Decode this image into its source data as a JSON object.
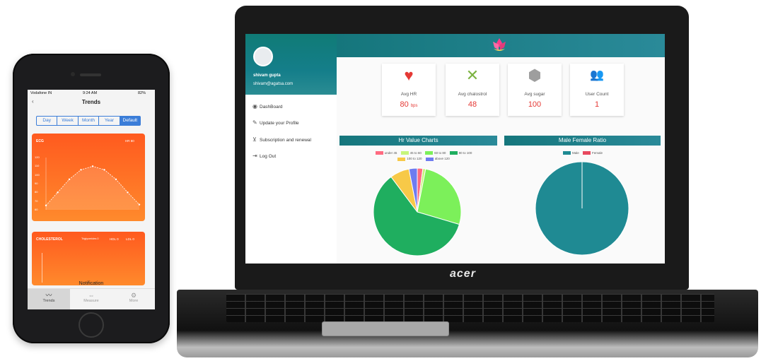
{
  "phone": {
    "status": {
      "carrier": "Vodafone IN",
      "time": "9:24 AM",
      "battery": "82%"
    },
    "title": "Trends",
    "segments": [
      "Day",
      "Week",
      "Month",
      "Year",
      "Default"
    ],
    "selected_segment": "Default",
    "ecg_card": {
      "title": "ECG",
      "right_label": "HR 80",
      "y_ticks": [
        "120",
        "110",
        "100",
        "90",
        "80",
        "70",
        "60"
      ]
    },
    "chol_card": {
      "title": "CHOLESTEROL",
      "right_labels": [
        "Triglycerides 0",
        "HDL 0",
        "LDL 0"
      ]
    },
    "notification": "Notification",
    "tabs": [
      {
        "label": "Trends",
        "icon": "trend-icon",
        "active": true
      },
      {
        "label": "Measure",
        "icon": "measure-icon",
        "active": false
      },
      {
        "label": "More",
        "icon": "more-icon",
        "active": false
      }
    ]
  },
  "laptop": {
    "brand": "acer",
    "user": {
      "name": "shivam gupta",
      "email": "shivam@agatsa.com"
    },
    "menu": [
      {
        "label": "DashBoard",
        "icon": "dashboard-icon"
      },
      {
        "label": "Update your Profile",
        "icon": "pencil-icon"
      },
      {
        "label": "Subscription and renewal",
        "icon": "cart-icon"
      },
      {
        "label": "Log Out",
        "icon": "logout-icon"
      }
    ],
    "stats": [
      {
        "label": "Avg HR",
        "value": "80",
        "unit": "bps",
        "icon": "heart-icon",
        "color": "#e53935"
      },
      {
        "label": "Avg chalostrol",
        "value": "48",
        "unit": "",
        "icon": "cutlery-icon",
        "color": "#7cb342"
      },
      {
        "label": "Avg sugar",
        "value": "100",
        "unit": "",
        "icon": "cube-icon",
        "color": "#9e9e9e"
      },
      {
        "label": "User Count",
        "value": "1",
        "unit": "",
        "icon": "users-icon",
        "color": "#42a5f5"
      }
    ],
    "hr_chart": {
      "title": "Hr Value Charts",
      "legend": [
        {
          "label": "under 45",
          "color": "#ff6b81"
        },
        {
          "label": "45 to 60",
          "color": "#c6f57a"
        },
        {
          "label": "60 to 80",
          "color": "#7cf05a"
        },
        {
          "label": "80 to 100",
          "color": "#1fae5f"
        },
        {
          "label": "100 to 120",
          "color": "#f7c948"
        },
        {
          "label": "above 120",
          "color": "#6f7cf0"
        }
      ]
    },
    "ratio_chart": {
      "title": "Male Female Ratio",
      "legend": [
        {
          "label": "Male",
          "color": "#1f8a93"
        },
        {
          "label": "Female",
          "color": "#e84a5f"
        }
      ]
    }
  },
  "chart_data": [
    {
      "type": "pie",
      "title": "Hr Value Charts",
      "categories": [
        "under 45",
        "45 to 60",
        "60 to 80",
        "80 to 100",
        "100 to 120",
        "above 120"
      ],
      "values": [
        2,
        1,
        26,
        59,
        7,
        3
      ],
      "colors": [
        "#ff6b81",
        "#c6f57a",
        "#7cf05a",
        "#1fae5f",
        "#f7c948",
        "#6f7cf0"
      ]
    },
    {
      "type": "pie",
      "title": "Male Female Ratio",
      "categories": [
        "Male",
        "Female"
      ],
      "values": [
        100,
        0
      ],
      "colors": [
        "#1f8a93",
        "#e84a5f"
      ]
    },
    {
      "type": "line",
      "title": "ECG",
      "x": [
        0,
        1,
        2,
        3,
        4,
        5,
        6,
        7,
        8
      ],
      "values": [
        65,
        80,
        95,
        106,
        110,
        106,
        95,
        80,
        66
      ],
      "ylim": [
        60,
        120
      ]
    }
  ]
}
